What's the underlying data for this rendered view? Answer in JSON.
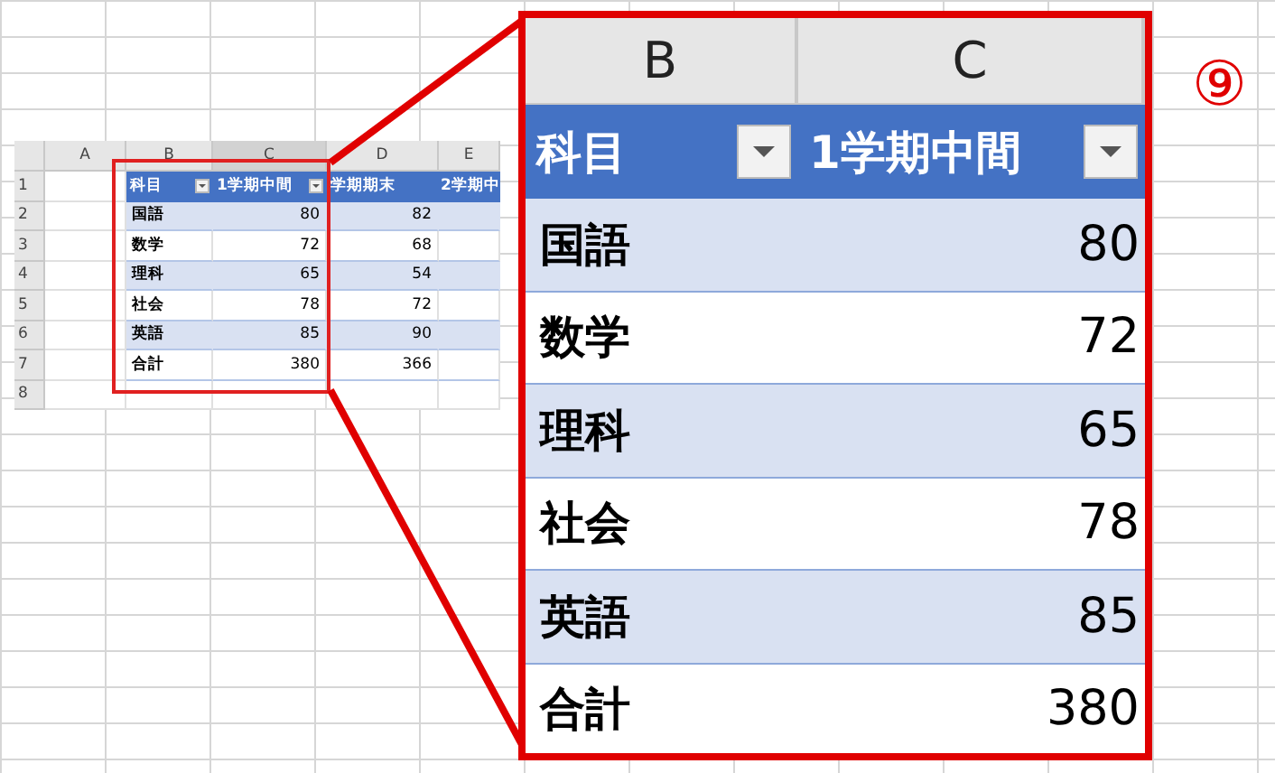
{
  "mini_sheet": {
    "columns": [
      "A",
      "B",
      "C",
      "D",
      "E"
    ],
    "row_numbers": [
      "1",
      "2",
      "3",
      "4",
      "5",
      "6",
      "7",
      "8"
    ],
    "header": [
      "科目",
      "1学期中間",
      "学期期末",
      "2学期中"
    ],
    "rows": [
      {
        "subject": "国語",
        "values": [
          "80",
          "82"
        ]
      },
      {
        "subject": "数学",
        "values": [
          "72",
          "68"
        ]
      },
      {
        "subject": "理科",
        "values": [
          "65",
          "54"
        ]
      },
      {
        "subject": "社会",
        "values": [
          "78",
          "72"
        ]
      },
      {
        "subject": "英語",
        "values": [
          "85",
          "90"
        ]
      },
      {
        "subject": "合計",
        "values": [
          "380",
          "366"
        ]
      }
    ]
  },
  "zoom_inset": {
    "columns": [
      "B",
      "C"
    ],
    "header": [
      "科目",
      "1学期中間"
    ],
    "rows": [
      {
        "subject": "国語",
        "value": "80"
      },
      {
        "subject": "数学",
        "value": "72"
      },
      {
        "subject": "理科",
        "value": "65"
      },
      {
        "subject": "社会",
        "value": "78"
      },
      {
        "subject": "英語",
        "value": "85"
      },
      {
        "subject": "合計",
        "value": "380"
      }
    ]
  },
  "step_marker": "⑨"
}
